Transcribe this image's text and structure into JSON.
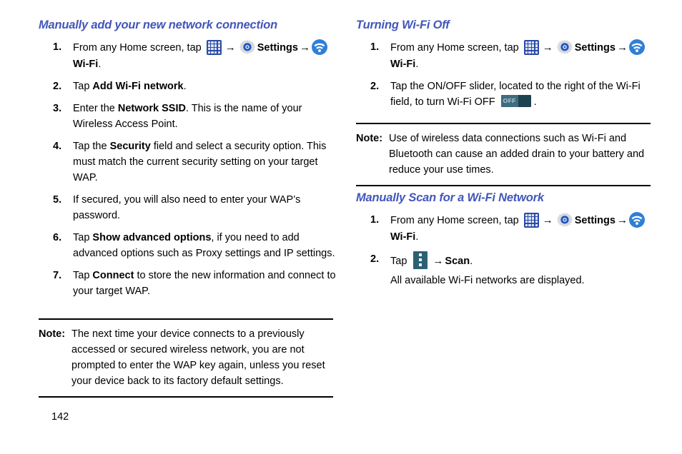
{
  "page": {
    "number": "142"
  },
  "left_column": {
    "heading": "Manually add your new network connection",
    "steps": [
      {
        "num": "1.",
        "parts": [
          {
            "t": "text",
            "v": "From any Home screen, tap "
          },
          {
            "t": "icon",
            "v": "apps-grid-icon"
          },
          {
            "t": "arrow",
            "v": "→"
          },
          {
            "t": "icon",
            "v": "settings-gear-icon"
          },
          {
            "t": "bold",
            "v": "Settings"
          },
          {
            "t": "arrow",
            "v": "→"
          },
          {
            "t": "icon",
            "v": "wifi-icon"
          },
          {
            "t": "bold",
            "v": "Wi-Fi"
          },
          {
            "t": "text",
            "v": "."
          }
        ]
      },
      {
        "num": "2.",
        "parts": [
          {
            "t": "text",
            "v": "Tap "
          },
          {
            "t": "bold",
            "v": "Add Wi-Fi network"
          },
          {
            "t": "text",
            "v": "."
          }
        ]
      },
      {
        "num": "3.",
        "parts": [
          {
            "t": "text",
            "v": "Enter the "
          },
          {
            "t": "bold",
            "v": "Network SSID"
          },
          {
            "t": "text",
            "v": ". This is the name of your Wireless Access Point."
          }
        ]
      },
      {
        "num": "4.",
        "parts": [
          {
            "t": "text",
            "v": "Tap the "
          },
          {
            "t": "bold",
            "v": "Security"
          },
          {
            "t": "text",
            "v": " field and select a security option. This must match the current security setting on your target WAP."
          }
        ]
      },
      {
        "num": "5.",
        "parts": [
          {
            "t": "text",
            "v": "If secured, you will also need to enter your WAP’s password."
          }
        ]
      },
      {
        "num": "6.",
        "parts": [
          {
            "t": "text",
            "v": "Tap "
          },
          {
            "t": "bold",
            "v": "Show advanced options"
          },
          {
            "t": "text",
            "v": ", if you need to add advanced options such as Proxy settings and IP settings."
          }
        ]
      },
      {
        "num": "7.",
        "parts": [
          {
            "t": "text",
            "v": "Tap "
          },
          {
            "t": "bold",
            "v": "Connect"
          },
          {
            "t": "text",
            "v": " to store the new information and connect to your target WAP."
          }
        ]
      }
    ],
    "note": {
      "label": "Note:",
      "text": "The next time your device connects to a previously accessed or secured wireless network, you are not prompted to enter the WAP key again, unless you reset your device back to its factory default settings."
    }
  },
  "right_column": {
    "heading_1": "Turning Wi-Fi Off",
    "steps_1": [
      {
        "num": "1.",
        "parts": [
          {
            "t": "text",
            "v": "From any Home screen, tap "
          },
          {
            "t": "icon",
            "v": "apps-grid-icon"
          },
          {
            "t": "arrow",
            "v": "→"
          },
          {
            "t": "icon",
            "v": "settings-gear-icon"
          },
          {
            "t": "bold",
            "v": "Settings"
          },
          {
            "t": "arrow",
            "v": "→"
          },
          {
            "t": "icon",
            "v": "wifi-icon"
          },
          {
            "t": "bold",
            "v": "Wi-Fi"
          },
          {
            "t": "text",
            "v": "."
          }
        ]
      },
      {
        "num": "2.",
        "parts": [
          {
            "t": "text",
            "v": "Tap the ON/OFF slider, located to the right of the Wi-Fi field, to turn Wi-Fi OFF "
          },
          {
            "t": "icon",
            "v": "off-slider-icon"
          },
          {
            "t": "text",
            "v": "."
          }
        ]
      }
    ],
    "note": {
      "label": "Note:",
      "text": "Use of wireless data connections such as Wi-Fi and Bluetooth can cause an added drain to your battery and reduce your use times."
    },
    "heading_2": "Manually Scan for a Wi-Fi Network",
    "steps_2": [
      {
        "num": "1.",
        "parts": [
          {
            "t": "text",
            "v": "From any Home screen, tap "
          },
          {
            "t": "icon",
            "v": "apps-grid-icon"
          },
          {
            "t": "arrow",
            "v": "→"
          },
          {
            "t": "icon",
            "v": "settings-gear-icon"
          },
          {
            "t": "bold",
            "v": "Settings"
          },
          {
            "t": "arrow",
            "v": "→"
          },
          {
            "t": "icon",
            "v": "wifi-icon"
          },
          {
            "t": "bold",
            "v": "Wi-Fi"
          },
          {
            "t": "text",
            "v": "."
          }
        ]
      },
      {
        "num": "2.",
        "parts": [
          {
            "t": "text",
            "v": "Tap "
          },
          {
            "t": "icon",
            "v": "overflow-menu-icon"
          },
          {
            "t": "arrow",
            "v": "→"
          },
          {
            "t": "bold",
            "v": "Scan"
          },
          {
            "t": "text",
            "v": "."
          }
        ]
      }
    ],
    "substep_text": "All available Wi-Fi networks are displayed.",
    "off_slider_label": "OFF"
  },
  "colors": {
    "heading_blue": "#4356ba",
    "apps_icon_blue": "#2a4ba8",
    "wifi_icon_blue": "#2f7fd6",
    "menu_icon_teal": "#2c6175",
    "slider_dark": "#1f4250",
    "slider_knob": "#3d6d7e"
  }
}
